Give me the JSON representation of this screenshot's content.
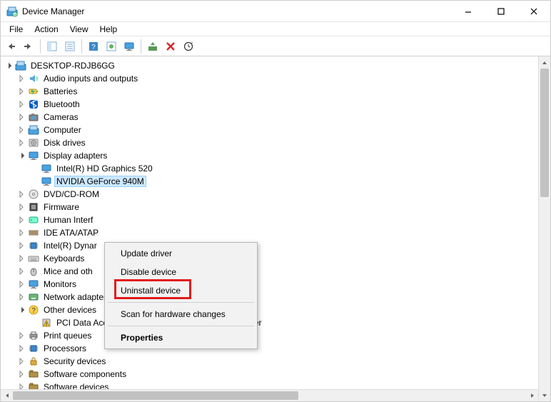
{
  "window": {
    "title": "Device Manager",
    "min_tooltip": "Minimize",
    "max_tooltip": "Maximize",
    "close_tooltip": "Close"
  },
  "menubar": [
    "File",
    "Action",
    "View",
    "Help"
  ],
  "root_node": "DESKTOP-RDJB6GG",
  "categories": [
    {
      "label": "Audio inputs and outputs",
      "icon": "audio",
      "collapsed": true
    },
    {
      "label": "Batteries",
      "icon": "battery",
      "collapsed": true
    },
    {
      "label": "Bluetooth",
      "icon": "bluetooth",
      "collapsed": true
    },
    {
      "label": "Cameras",
      "icon": "camera",
      "collapsed": true
    },
    {
      "label": "Computer",
      "icon": "computer",
      "collapsed": true
    },
    {
      "label": "Disk drives",
      "icon": "disk",
      "collapsed": true
    },
    {
      "label": "Display adapters",
      "icon": "display",
      "collapsed": false,
      "children": [
        {
          "label": "Intel(R) HD Graphics 520",
          "icon": "display"
        },
        {
          "label": "NVIDIA GeForce 940M",
          "icon": "display",
          "selected": true
        }
      ]
    },
    {
      "label": "DVD/CD-ROM",
      "icon": "dvd",
      "collapsed": true,
      "truncated": true
    },
    {
      "label": "Firmware",
      "icon": "firmware",
      "collapsed": true
    },
    {
      "label": "Human Interf",
      "icon": "hid",
      "collapsed": true,
      "truncated": true
    },
    {
      "label": "IDE ATA/ATAP",
      "icon": "ide",
      "collapsed": true,
      "truncated": true
    },
    {
      "label": "Intel(R) Dynar",
      "icon": "intel",
      "collapsed": true,
      "truncated": true
    },
    {
      "label": "Keyboards",
      "icon": "keyboard",
      "collapsed": true
    },
    {
      "label": "Mice and oth",
      "icon": "mouse",
      "collapsed": true,
      "truncated": true
    },
    {
      "label": "Monitors",
      "icon": "monitor",
      "collapsed": true
    },
    {
      "label": "Network adapters",
      "icon": "network",
      "collapsed": true
    },
    {
      "label": "Other devices",
      "icon": "other",
      "collapsed": false,
      "children": [
        {
          "label": "PCI Data Acquisition and Signal Processing Controller",
          "icon": "warn"
        }
      ]
    },
    {
      "label": "Print queues",
      "icon": "printer",
      "collapsed": true
    },
    {
      "label": "Processors",
      "icon": "cpu",
      "collapsed": true
    },
    {
      "label": "Security devices",
      "icon": "security",
      "collapsed": true
    },
    {
      "label": "Software components",
      "icon": "software",
      "collapsed": true
    },
    {
      "label": "Software devices",
      "icon": "software",
      "collapsed": true,
      "cutoff": true
    }
  ],
  "context_menu": {
    "items": [
      {
        "label": "Update driver"
      },
      {
        "label": "Disable device"
      },
      {
        "label": "Uninstall device",
        "highlighted": true
      },
      {
        "sep": true
      },
      {
        "label": "Scan for hardware changes"
      },
      {
        "sep": true
      },
      {
        "label": "Properties",
        "bold": true
      }
    ]
  }
}
